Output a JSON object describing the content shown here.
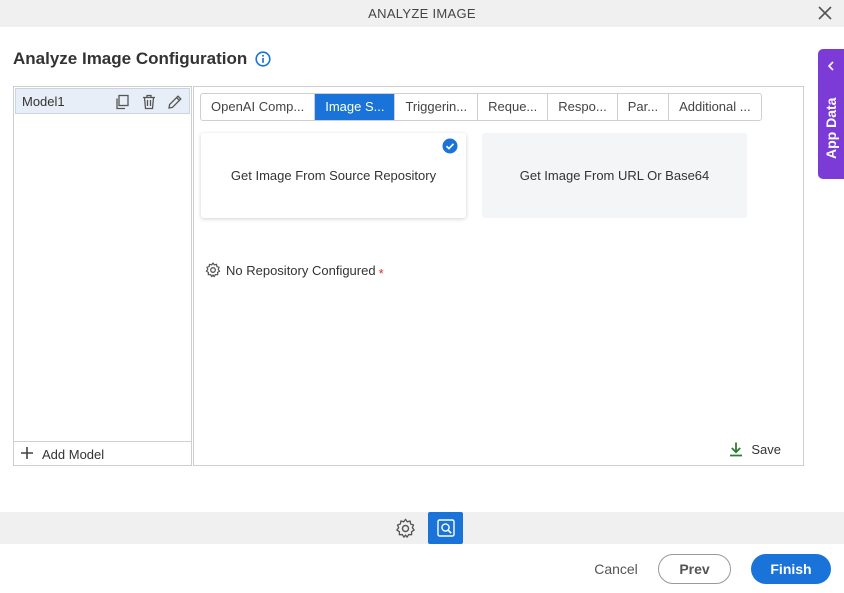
{
  "window": {
    "title": "ANALYZE IMAGE"
  },
  "page": {
    "heading": "Analyze Image Configuration"
  },
  "side_panel": {
    "label": "App Data"
  },
  "models": {
    "items": [
      {
        "label": "Model1"
      }
    ],
    "add_label": "Add Model"
  },
  "tabs": [
    {
      "label": "OpenAI Comp...",
      "active": false
    },
    {
      "label": "Image S...",
      "active": true
    },
    {
      "label": "Triggerin...",
      "active": false
    },
    {
      "label": "Reque...",
      "active": false
    },
    {
      "label": "Respo...",
      "active": false
    },
    {
      "label": "Par...",
      "active": false
    },
    {
      "label": "Additional ...",
      "active": false
    }
  ],
  "source_options": [
    {
      "label": "Get Image From Source Repository",
      "selected": true
    },
    {
      "label": "Get Image From URL Or Base64",
      "selected": false
    }
  ],
  "repository": {
    "label": "No Repository Configured",
    "required_marker": "*"
  },
  "actions": {
    "save_label": "Save"
  },
  "footer": {
    "cancel_label": "Cancel",
    "prev_label": "Prev",
    "finish_label": "Finish"
  },
  "colors": {
    "accent": "#1a73d9",
    "app_data": "#7c3bd6",
    "save_icon": "#2e7d32",
    "required": "#d32f2f"
  }
}
